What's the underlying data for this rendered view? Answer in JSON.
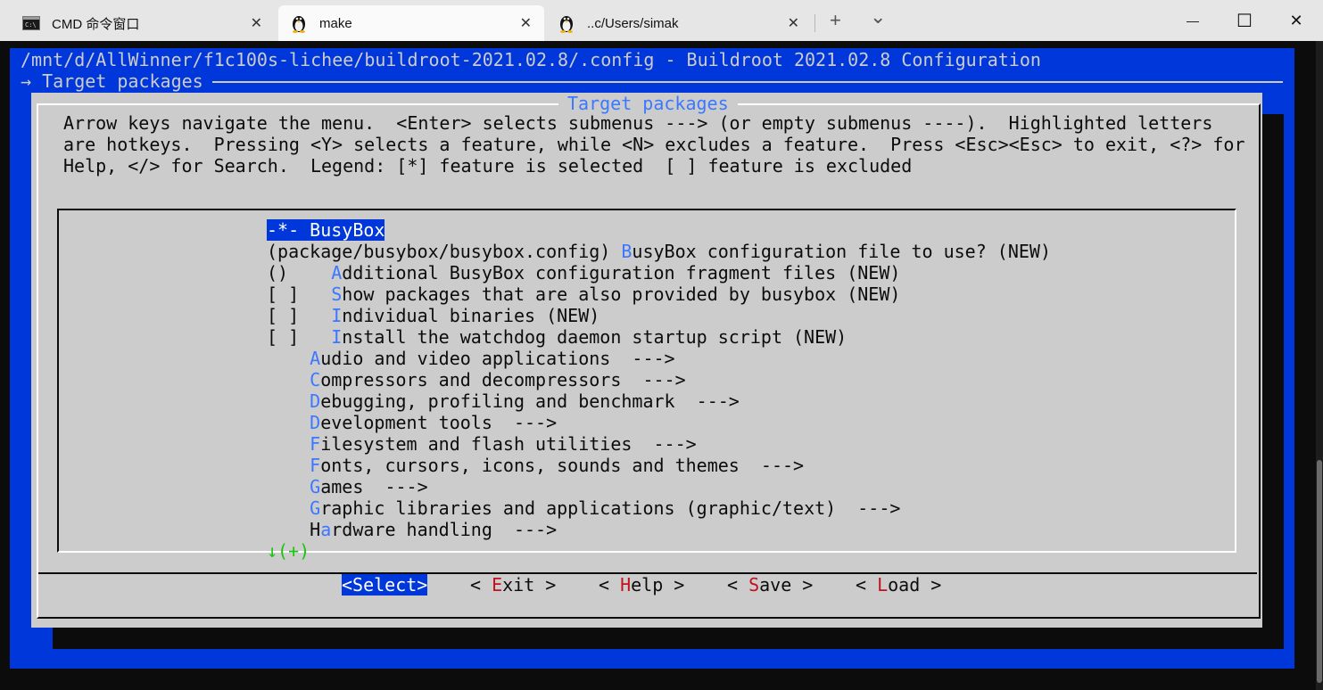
{
  "window": {
    "tabs": [
      {
        "title": "CMD 命令窗口",
        "icon": "cmd-icon",
        "active": false
      },
      {
        "title": "make",
        "icon": "linux-penguin-icon",
        "active": true
      },
      {
        "title": "..c/Users/simak",
        "icon": "linux-penguin-icon",
        "active": false
      }
    ],
    "new_tab_label": "+",
    "dropdown_label": "⌄",
    "controls": {
      "minimize": "—",
      "maximize": "☐",
      "close": "✕"
    }
  },
  "terminal": {
    "path_line": "/mnt/d/AllWinner/f1c100s-lichee/buildroot-2021.02.8/.config - Buildroot 2021.02.8 Configuration",
    "breadcrumb": "→ Target packages",
    "dialog_title": "Target packages",
    "help_lines": [
      "Arrow keys navigate the menu.  <Enter> selects submenus ---> (or empty submenus ----).  Highlighted letters",
      "are hotkeys.  Pressing <Y> selects a feature, while <N> excludes a feature.  Press <Esc><Esc> to exit, <?> for",
      "Help, </> for Search.  Legend: [*] feature is selected  [ ] feature is excluded"
    ],
    "menu": [
      {
        "prefix": "-*- ",
        "hk": "",
        "pre": "",
        "rest": "BusyBox",
        "selected": true
      },
      {
        "prefix": "(package/busybox/busybox.config) ",
        "hk": "B",
        "pre": "",
        "rest": "usyBox configuration file to use? (NEW)",
        "selected": false
      },
      {
        "prefix": "()    ",
        "hk": "A",
        "pre": "",
        "rest": "dditional BusyBox configuration fragment files (NEW)",
        "selected": false
      },
      {
        "prefix": "[ ]   ",
        "hk": "S",
        "pre": "",
        "rest": "how packages that are also provided by busybox (NEW)",
        "selected": false
      },
      {
        "prefix": "[ ]   ",
        "hk": "I",
        "pre": "",
        "rest": "ndividual binaries (NEW)",
        "selected": false
      },
      {
        "prefix": "[ ]   ",
        "hk": "I",
        "pre": "",
        "rest": "nstall the watchdog daemon startup script (NEW)",
        "selected": false
      },
      {
        "prefix": "    ",
        "hk": "A",
        "pre": "",
        "rest": "udio and video applications  --->",
        "selected": false
      },
      {
        "prefix": "    ",
        "hk": "C",
        "pre": "",
        "rest": "ompressors and decompressors  --->",
        "selected": false
      },
      {
        "prefix": "    ",
        "hk": "D",
        "pre": "",
        "rest": "ebugging, profiling and benchmark  --->",
        "selected": false
      },
      {
        "prefix": "    ",
        "hk": "D",
        "pre": "",
        "rest": "evelopment tools  --->",
        "selected": false
      },
      {
        "prefix": "    ",
        "hk": "F",
        "pre": "",
        "rest": "ilesystem and flash utilities  --->",
        "selected": false
      },
      {
        "prefix": "    ",
        "hk": "F",
        "pre": "",
        "rest": "onts, cursors, icons, sounds and themes  --->",
        "selected": false
      },
      {
        "prefix": "    ",
        "hk": "G",
        "pre": "",
        "rest": "ames  --->",
        "selected": false
      },
      {
        "prefix": "    ",
        "hk": "G",
        "pre": "",
        "rest": "raphic libraries and applications (graphic/text)  --->",
        "selected": false
      },
      {
        "prefix": "    ",
        "hk": "a",
        "pre": "H",
        "rest": "rdware handling  --->",
        "selected": false
      }
    ],
    "more_indicator": "↓(+)",
    "buttons": [
      {
        "pre": "<",
        "hk": "",
        "rest": "Select>",
        "full": "<Select>",
        "active": true
      },
      {
        "pre": "< ",
        "hk": "E",
        "rest": "xit >",
        "active": false
      },
      {
        "pre": "< ",
        "hk": "H",
        "rest": "elp >",
        "active": false
      },
      {
        "pre": "< ",
        "hk": "S",
        "rest": "ave >",
        "active": false
      },
      {
        "pre": "< ",
        "hk": "L",
        "rest": "oad >",
        "active": false
      }
    ]
  },
  "colors": {
    "tab_bar": "#e6e6e6",
    "terminal_bg": "#0c0c0c",
    "blue_bg": "#0037da",
    "dialog_bg": "#cccccc",
    "hotkey": "#3b78ff",
    "button_hotkey": "#c50f1f",
    "more_indicator": "#16c60c"
  }
}
